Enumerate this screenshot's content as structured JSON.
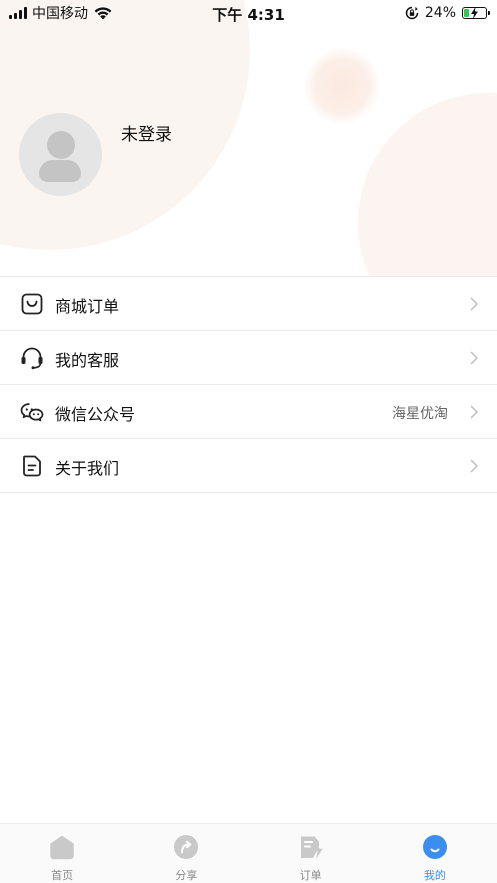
{
  "status_bar": {
    "carrier": "中国移动",
    "time": "下午 4:31",
    "battery_percent": "24%",
    "battery_level": 0.24,
    "battery_color": "#36c44a"
  },
  "profile": {
    "login_status": "未登录",
    "avatar_icon": "user-placeholder-icon"
  },
  "menu": {
    "items": [
      {
        "label": "商城订单",
        "icon": "shopping-bag-icon",
        "value": ""
      },
      {
        "label": "我的客服",
        "icon": "headset-icon",
        "value": ""
      },
      {
        "label": "微信公众号",
        "icon": "wechat-icon",
        "value": "海星优淘"
      },
      {
        "label": "关于我们",
        "icon": "document-icon",
        "value": ""
      }
    ]
  },
  "tab_bar": {
    "active_color": "#3b8ef0",
    "inactive_color": "#8a8a8a",
    "tabs": [
      {
        "label": "首页",
        "icon": "home-icon",
        "active": false
      },
      {
        "label": "分享",
        "icon": "share-icon",
        "active": false
      },
      {
        "label": "订单",
        "icon": "order-icon",
        "active": false
      },
      {
        "label": "我的",
        "icon": "profile-icon",
        "active": true
      }
    ]
  }
}
